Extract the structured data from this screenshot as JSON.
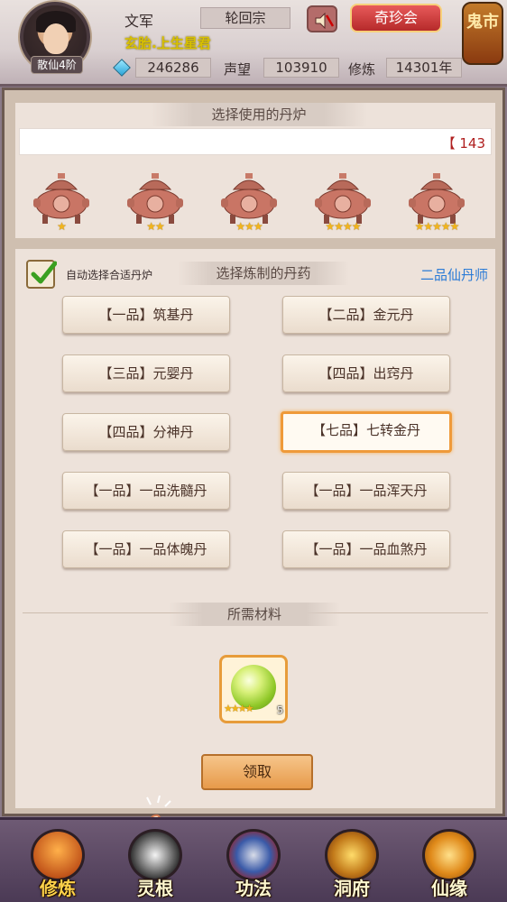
{
  "header": {
    "avatar_rank": "散仙4阶",
    "player_name": "文军",
    "sect": "轮回宗",
    "title": "玄胎.上生星君",
    "treasure_button": "奇珍会",
    "ghost_market": "鬼市",
    "currency_value": "246286",
    "prestige_label": "声望",
    "prestige_value": "103910",
    "cultivation_label": "修炼",
    "cultivation_value": "14301年"
  },
  "furnace_section": {
    "title": "选择使用的丹炉",
    "counter": "【 143",
    "furnaces": [
      {
        "stars": "★"
      },
      {
        "stars": "★★"
      },
      {
        "stars": "★★★"
      },
      {
        "stars": "★★★★"
      },
      {
        "stars": "★★★★★"
      }
    ]
  },
  "recipe_section": {
    "auto_label": "自动选择合适丹炉",
    "auto_checked": true,
    "title": "选择炼制的丹药",
    "rank_link": "二品仙丹师",
    "recipes": [
      {
        "label": "【一品】筑基丹",
        "selected": false
      },
      {
        "label": "【二品】金元丹",
        "selected": false
      },
      {
        "label": "【三品】元婴丹",
        "selected": false
      },
      {
        "label": "【四品】出窍丹",
        "selected": false
      },
      {
        "label": "【四品】分神丹",
        "selected": false
      },
      {
        "label": "【七品】七转金丹",
        "selected": true
      },
      {
        "label": "【一品】一品洗髓丹",
        "selected": false
      },
      {
        "label": "【一品】一品浑天丹",
        "selected": false
      },
      {
        "label": "【一品】一品体魄丹",
        "selected": false
      },
      {
        "label": "【一品】一品血煞丹",
        "selected": false
      }
    ],
    "materials_title": "所需材料",
    "material_stars": "★★★★",
    "material_count": "5",
    "collect_button": "领取"
  },
  "bottom_nav": [
    {
      "label": "修炼",
      "icon": "cultivate-icon",
      "active": true
    },
    {
      "label": "灵根",
      "icon": "spirit-root-icon",
      "active": false
    },
    {
      "label": "功法",
      "icon": "technique-icon",
      "active": false
    },
    {
      "label": "洞府",
      "icon": "cave-dwelling-icon",
      "active": false
    },
    {
      "label": "仙缘",
      "icon": "immortal-fate-icon",
      "active": false
    }
  ],
  "colors": {
    "accent_red": "#b62a2a",
    "link_blue": "#2b7bd6",
    "title_yellow": "#d8c000",
    "selected_border": "#ef9a3a"
  }
}
